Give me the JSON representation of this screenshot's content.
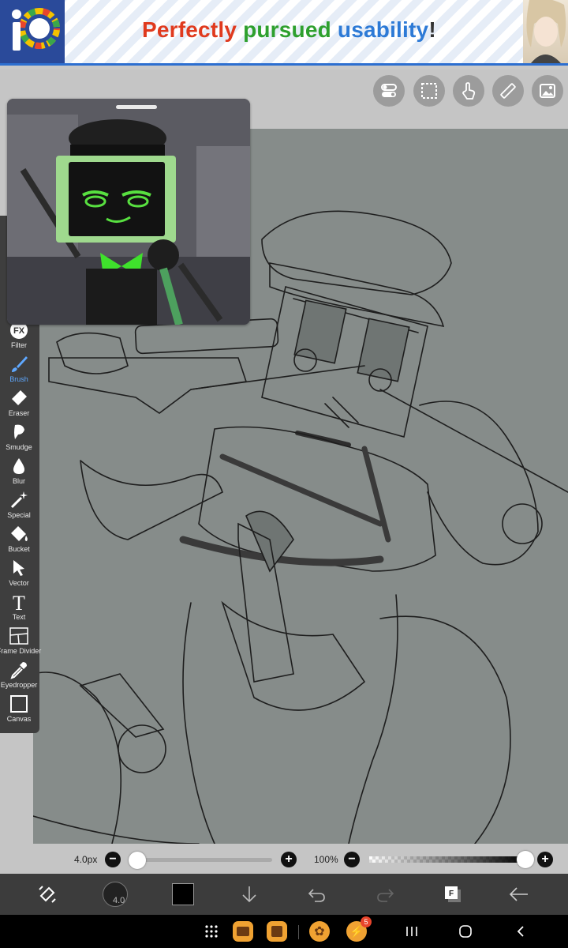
{
  "ad": {
    "word1": "Perfectly",
    "word2": "pursued",
    "word3": "usability",
    "mark": "!",
    "color1": "#e03a1e",
    "color2": "#2ea02e",
    "color3": "#2d7ad6",
    "logo_text": "iP"
  },
  "top_toolbar": [
    "toggle-icon",
    "selection-icon",
    "touch-icon",
    "ruler-icon",
    "image-icon"
  ],
  "tools": [
    {
      "label": "Filter",
      "icon": "fx-icon"
    },
    {
      "label": "Brush",
      "icon": "brush-icon",
      "active": true
    },
    {
      "label": "Eraser",
      "icon": "eraser-icon"
    },
    {
      "label": "Smudge",
      "icon": "smudge-icon"
    },
    {
      "label": "Blur",
      "icon": "blur-icon"
    },
    {
      "label": "Special",
      "icon": "special-icon"
    },
    {
      "label": "Bucket",
      "icon": "bucket-icon"
    },
    {
      "label": "Vector",
      "icon": "vector-icon"
    },
    {
      "label": "Text",
      "icon": "text-icon"
    },
    {
      "label": "Frame Divider",
      "icon": "frame-divider-icon"
    },
    {
      "label": "Eyedropper",
      "icon": "eyedropper-icon"
    },
    {
      "label": "Canvas",
      "icon": "canvas-icon"
    }
  ],
  "brush": {
    "size_label": "4.0px",
    "size_fraction": 0.05,
    "badge": "4.0"
  },
  "opacity": {
    "label": "100%",
    "fraction": 1.0
  },
  "color": {
    "current": "#000000",
    "accent": "#2d7ad6"
  },
  "notifications": {
    "messenger_badge": "5"
  }
}
